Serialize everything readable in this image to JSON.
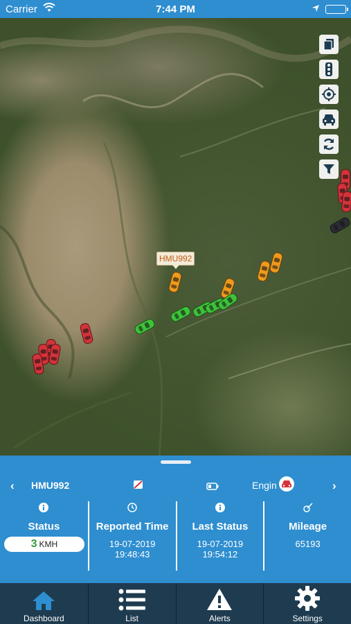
{
  "status_bar": {
    "carrier": "Carrier",
    "time": "7:44 PM"
  },
  "map": {
    "tools": [
      "document-icon",
      "traffic-light-icon",
      "locate-icon",
      "car-icon",
      "refresh-icon",
      "filter-icon"
    ],
    "selected_vehicle_label": "HMU992",
    "marker_colors": {
      "stopped": "#d3333a",
      "idle": "#ee9a1c",
      "moving": "#3ec23a",
      "offline": "#2c2c34"
    }
  },
  "vehicle_panel": {
    "vehicle_id": "HMU992",
    "engine_label": "Engin",
    "status": {
      "title": "Status",
      "speed_value": "3",
      "speed_unit": "KMH"
    },
    "reported_time": {
      "title": "Reported Time",
      "date": "19-07-2019",
      "time": "19:48:43"
    },
    "last_status": {
      "title": "Last Status",
      "date": "19-07-2019",
      "time": "19:54:12"
    },
    "mileage": {
      "title": "Mileage",
      "value": "65193"
    },
    "accent_color": "#2e8ed0"
  },
  "tab_bar": {
    "tabs": [
      {
        "label": "Dashboard",
        "icon": "home-icon",
        "active": true
      },
      {
        "label": "List",
        "icon": "list-icon",
        "active": false
      },
      {
        "label": "Alerts",
        "icon": "alert-icon",
        "active": false
      },
      {
        "label": "Settings",
        "icon": "gear-icon",
        "active": false
      }
    ],
    "background": "#1e3b50"
  }
}
